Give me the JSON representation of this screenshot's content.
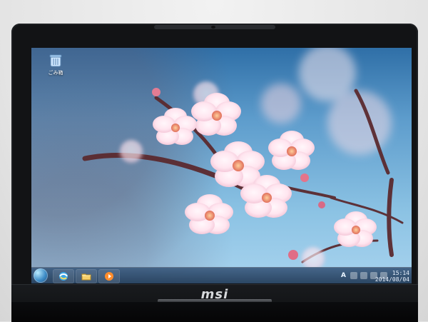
{
  "desktop": {
    "icons": [
      {
        "label": "ごみ箱",
        "icon": "recycle-bin-icon"
      }
    ]
  },
  "taskbar": {
    "pinned": [
      "ie-icon",
      "explorer-folder-icon",
      "media-player-icon"
    ],
    "tray": {
      "ime_label": "A"
    },
    "clock": {
      "time": "15:14",
      "date": "2014/08/04"
    }
  },
  "device": {
    "brand": "msi"
  },
  "colors": {
    "sky": "#7fb6d8",
    "blossom": "#fff0f5"
  }
}
